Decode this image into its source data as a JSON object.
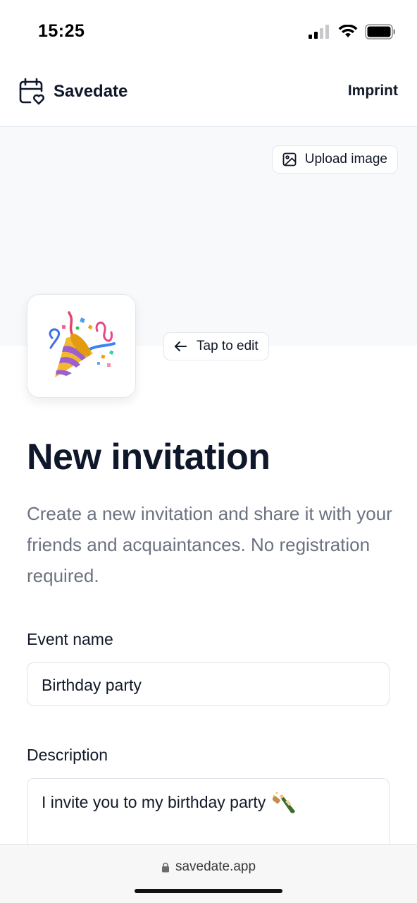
{
  "status_bar": {
    "time": "15:25"
  },
  "header": {
    "brand": "Savedate",
    "imprint": "Imprint"
  },
  "cover": {
    "upload_label": "Upload image"
  },
  "emoji": {
    "icon": "party-popper"
  },
  "tap_edit": {
    "label": "Tap to edit"
  },
  "main": {
    "title": "New invitation",
    "description": "Create a new invitation and share it with your friends and acquaintances. No registration required."
  },
  "form": {
    "event_name_label": "Event name",
    "event_name_value": "Birthday party",
    "description_label": "Description",
    "description_value": "I invite you to my birthday party",
    "description_emoji": "bottle-with-popping-cork"
  },
  "browser": {
    "url": "savedate.app"
  },
  "colors": {
    "text": "#0f172a",
    "muted": "#6b7280",
    "border": "#e2e8f0",
    "cover": "#f8f9fb"
  }
}
